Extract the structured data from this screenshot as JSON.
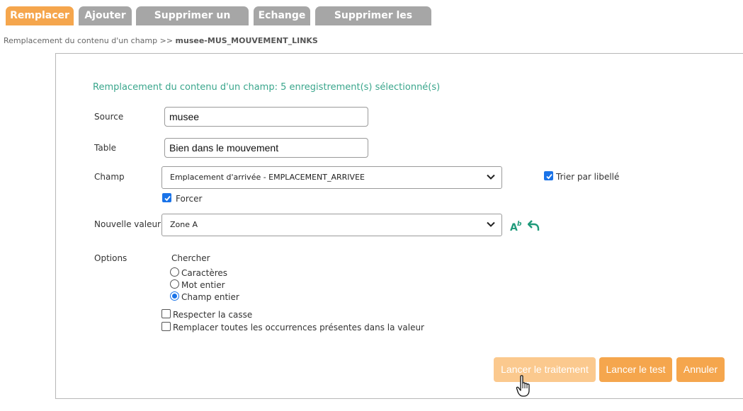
{
  "tabs": [
    {
      "label": "Remplacer",
      "active": true
    },
    {
      "label": "Ajouter",
      "active": false
    },
    {
      "label": "Supprimer un champ",
      "active": false
    },
    {
      "label": "Echange",
      "active": false
    },
    {
      "label": "Supprimer les notices",
      "active": false
    }
  ],
  "breadcrumb": {
    "prefix": "Remplacement du contenu d'un champ >>",
    "current": "musee-MUS_MOUVEMENT_LINKS"
  },
  "form": {
    "heading": "Remplacement du contenu d'un champ: 5 enregistrement(s) sélectionné(s)",
    "source": {
      "label": "Source",
      "value": "musee"
    },
    "table": {
      "label": "Table",
      "value": "Bien dans le mouvement"
    },
    "champ": {
      "label": "Champ",
      "value": "Emplacement d'arrivée - EMPLACEMENT_ARRIVEE"
    },
    "trier": {
      "label": "Trier par libellé",
      "checked": true
    },
    "forcer": {
      "label": "Forcer",
      "checked": true
    },
    "nouvelle_valeur": {
      "label": "Nouvelle valeur",
      "value": "Zone A"
    },
    "options": {
      "label": "Options",
      "chercher": "Chercher",
      "radios": [
        {
          "label": "Caractères",
          "selected": false
        },
        {
          "label": "Mot entier",
          "selected": false
        },
        {
          "label": "Champ entier",
          "selected": true
        }
      ],
      "respecter_casse": {
        "label": "Respecter la casse",
        "checked": false
      },
      "remplacer_toutes": {
        "label": "Remplacer toutes les occurrences présentes dans la valeur",
        "checked": false
      }
    }
  },
  "buttons": {
    "lancer_traitement": "Lancer le traitement",
    "lancer_test": "Lancer le test",
    "annuler": "Annuler"
  },
  "colors": {
    "accent": "#f5a64d",
    "tab_inactive": "#a6a6a6",
    "heading": "#3aa68c",
    "icon_green": "#1f9a7a",
    "checkbox": "#1a73e8"
  }
}
